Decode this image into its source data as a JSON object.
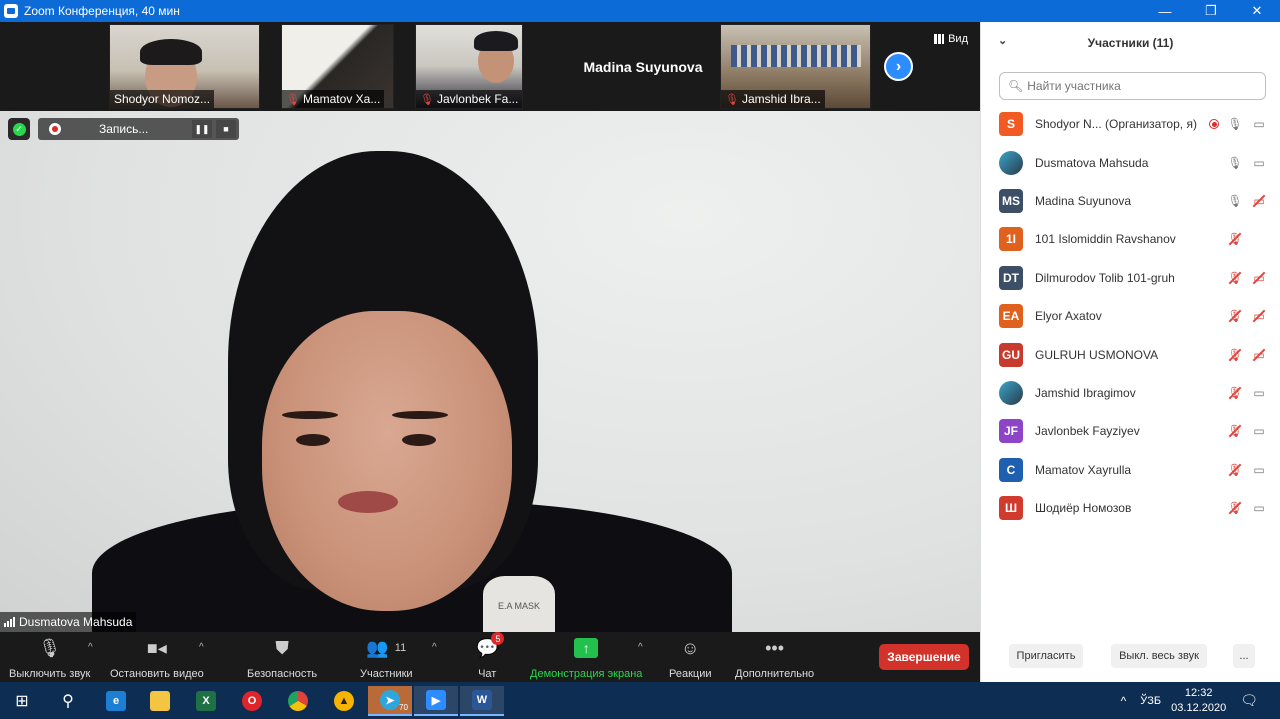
{
  "window": {
    "title": "Zoom Конференция, 40 мин",
    "controls": [
      "—",
      "❐",
      "✕"
    ]
  },
  "thumbnails": [
    {
      "name": "Shodyor Nomoz...",
      "muted": false
    },
    {
      "name": "Mamatov Xa...",
      "muted": true
    },
    {
      "name": "Javlonbek Fa...",
      "muted": true
    },
    {
      "name": "Madina Suyunova",
      "muted": false
    },
    {
      "name": "Jamshid Ibra...",
      "muted": true
    }
  ],
  "view_label": "Вид",
  "recording": {
    "label": "Запись...",
    "pause": "❚❚",
    "stop": "■"
  },
  "active_speaker": {
    "name": "Dusmatova Mahsuda"
  },
  "badge_text": "E.A MASK",
  "toolbar": {
    "mute_label": "Выключить звук",
    "video_label": "Остановить видео",
    "security_label": "Безопасность",
    "participants_label": "Участники",
    "participants_count": "11",
    "chat_label": "Чат",
    "chat_badge": "5",
    "share_label": "Демонстрация экрана",
    "reactions_label": "Реакции",
    "more_label": "Дополнительно",
    "end_label": "Завершение"
  },
  "panel": {
    "title": "Участники (11)",
    "search_placeholder": "Найти участника",
    "participants": [
      {
        "initials": "S",
        "color": "#f25a24",
        "name": "Shodyor N...  (Организатор, я)",
        "recording": true,
        "mic": "on",
        "video": "on"
      },
      {
        "initials": "",
        "color": "#ffffff",
        "name": "Dusmatova Mahsuda",
        "mic": "on",
        "video": "on",
        "image": true
      },
      {
        "initials": "MS",
        "color": "#3d4f66",
        "name": "Madina Suyunova",
        "mic": "on",
        "video": "off"
      },
      {
        "initials": "1I",
        "color": "#e0601e",
        "name": "101 Islomiddin Ravshanov",
        "mic": "off",
        "video": "none"
      },
      {
        "initials": "DT",
        "color": "#3d4f66",
        "name": "Dilmurodov Tolib 101-gruh",
        "mic": "off",
        "video": "off"
      },
      {
        "initials": "EA",
        "color": "#e0601e",
        "name": "Elyor Axatov",
        "mic": "off",
        "video": "off"
      },
      {
        "initials": "GU",
        "color": "#c93a2e",
        "name": "GULRUH USMONOVA",
        "mic": "off",
        "video": "off"
      },
      {
        "initials": "",
        "color": "#ffffff",
        "name": "Jamshid Ibragimov",
        "mic": "off",
        "video": "on",
        "image": true
      },
      {
        "initials": "JF",
        "color": "#8e44c7",
        "name": "Javlonbek Fayziyev",
        "mic": "off",
        "video": "on"
      },
      {
        "initials": "C",
        "color": "#1f5fb0",
        "name": "Mamatov Xayrulla",
        "mic": "off",
        "video": "on"
      },
      {
        "initials": "Ш",
        "color": "#d03b2e",
        "name": "Шодиёр Номозов",
        "mic": "off",
        "video": "on"
      }
    ],
    "invite_label": "Пригласить",
    "mute_all_label": "Выкл. весь звук",
    "more_label": "..."
  },
  "taskbar": {
    "time": "12:32",
    "date": "03.12.2020",
    "lang": "ЎЗБ",
    "telegram_badge": "70"
  }
}
